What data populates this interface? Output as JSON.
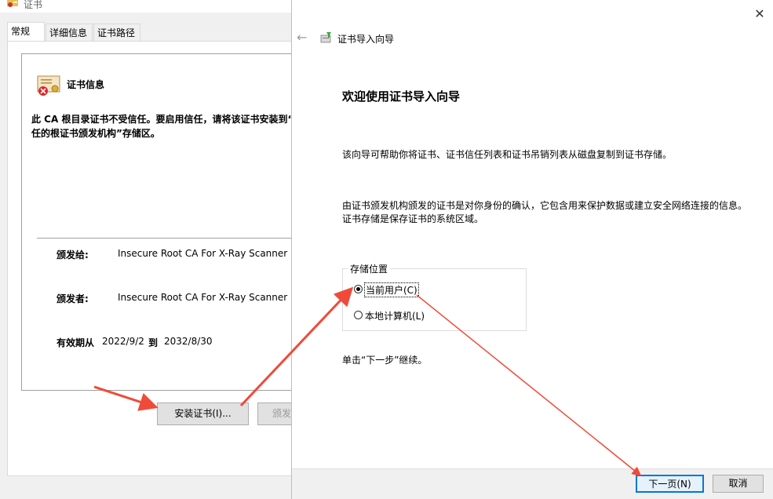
{
  "cert_dialog": {
    "title": "证书",
    "tabs": [
      {
        "label": "常规",
        "active": true
      },
      {
        "label": "详细信息",
        "active": false
      },
      {
        "label": "证书路径",
        "active": false
      }
    ],
    "info_heading": "证书信息",
    "warning": "此 CA 根目录证书不受信任。要启用信任，请将该证书安装到“受信任的根证书颁发机构”存储区。",
    "warning_line1": "此 CA 根目录证书不受信任。要启用信任，请将该证书安装到“",
    "warning_line2": "任的根证书颁发机构”存储区。",
    "issued_to_label": "颁发给:",
    "issued_to_value": "Insecure Root CA For X-Ray Scanner",
    "issued_by_label": "颁发者:",
    "issued_by_value": "Insecure Root CA For X-Ray Scanner",
    "validity_from_label": "有效期从",
    "validity_from": "2022/9/2",
    "validity_to_label": "到",
    "validity_to": "2032/8/30",
    "install_button": "安装证书(I)...",
    "issuer_statement_button": "颁发"
  },
  "wizard": {
    "close_glyph": "✕",
    "back_glyph": "←",
    "title": "证书导入向导",
    "heading": "欢迎使用证书导入向导",
    "desc1": "该向导可帮助你将证书、证书信任列表和证书吊销列表从磁盘复制到证书存储。",
    "desc2": "由证书颁发机构颁发的证书是对你身份的确认，它包含用来保护数据或建立安全网络连接的信息。证书存储是保存证书的系统区域。",
    "store_location": {
      "legend": "存储位置",
      "options": [
        {
          "label": "当前用户(C)",
          "selected": true
        },
        {
          "label": "本地计算机(L)",
          "selected": false
        }
      ]
    },
    "hint": "单击“下一步”继续。",
    "next_button": "下一页(N)",
    "cancel_button": "取消"
  },
  "colors": {
    "dialog_bg": "#f0f0f0",
    "accent": "#0078d7",
    "annotation_arrow": "#f04a3a"
  }
}
